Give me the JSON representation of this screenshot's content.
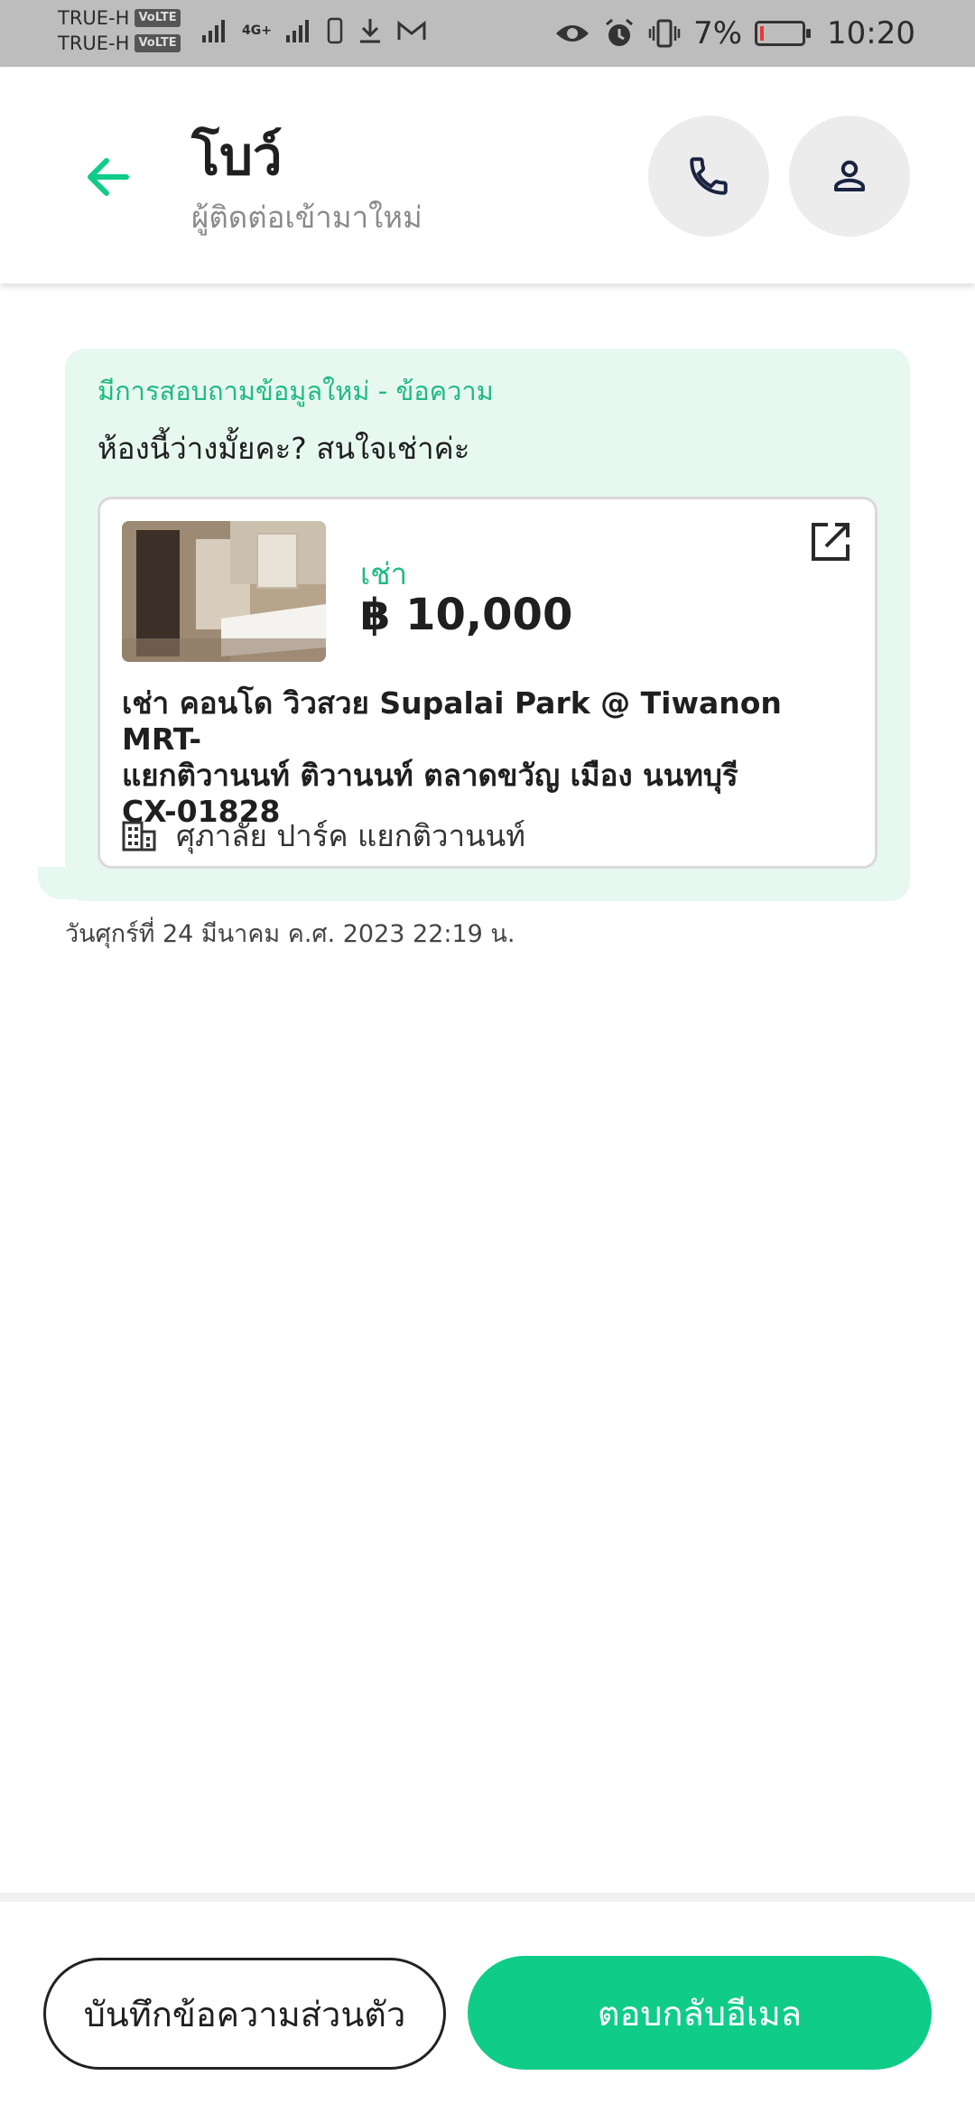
{
  "status_bar": {
    "carrier1": "TRUE-H",
    "carrier2": "TRUE-H",
    "volte": "VoLTE",
    "network": "4G+",
    "battery_percent": "7%",
    "battery_level": 0.07,
    "time": "10:20"
  },
  "header": {
    "title": "โบว์",
    "subtitle": "ผู้ติดต่อเข้ามาใหม่",
    "icons": {
      "back": "arrow-left-icon",
      "call": "phone-icon",
      "profile": "person-icon"
    }
  },
  "message": {
    "label": "มีการสอบถามข้อมูลใหม่ - ข้อความ",
    "text": "ห้องนี้ว่างมั้ยคะ? สนใจเช่าค่ะ",
    "timestamp": "วันศุกร์ที่ 24 มีนาคม ค.ศ. 2023 22:19 น."
  },
  "listing": {
    "type": "เช่า",
    "price": "฿ 10,000",
    "title_line1": "เช่า คอนโด วิวสวย Supalai Park @ Tiwanon MRT-",
    "title_line2": "แยกติวานนท์ ติวานนท์ ตลาดขวัญ เมือง นนทบุรี",
    "title_line3": "CX-01828",
    "project": "ศุภาลัย ปาร์ค แยกติวานนท์",
    "icons": {
      "external": "open-external-icon",
      "building": "building-icon"
    }
  },
  "actions": {
    "note_button": "บันทึกข้อความส่วนตัว",
    "reply_button": "ตอบกลับอีเมล"
  },
  "colors": {
    "accent": "#10cc89",
    "bubble": "#e7f8f1",
    "status_bar": "#bdbdbd"
  }
}
